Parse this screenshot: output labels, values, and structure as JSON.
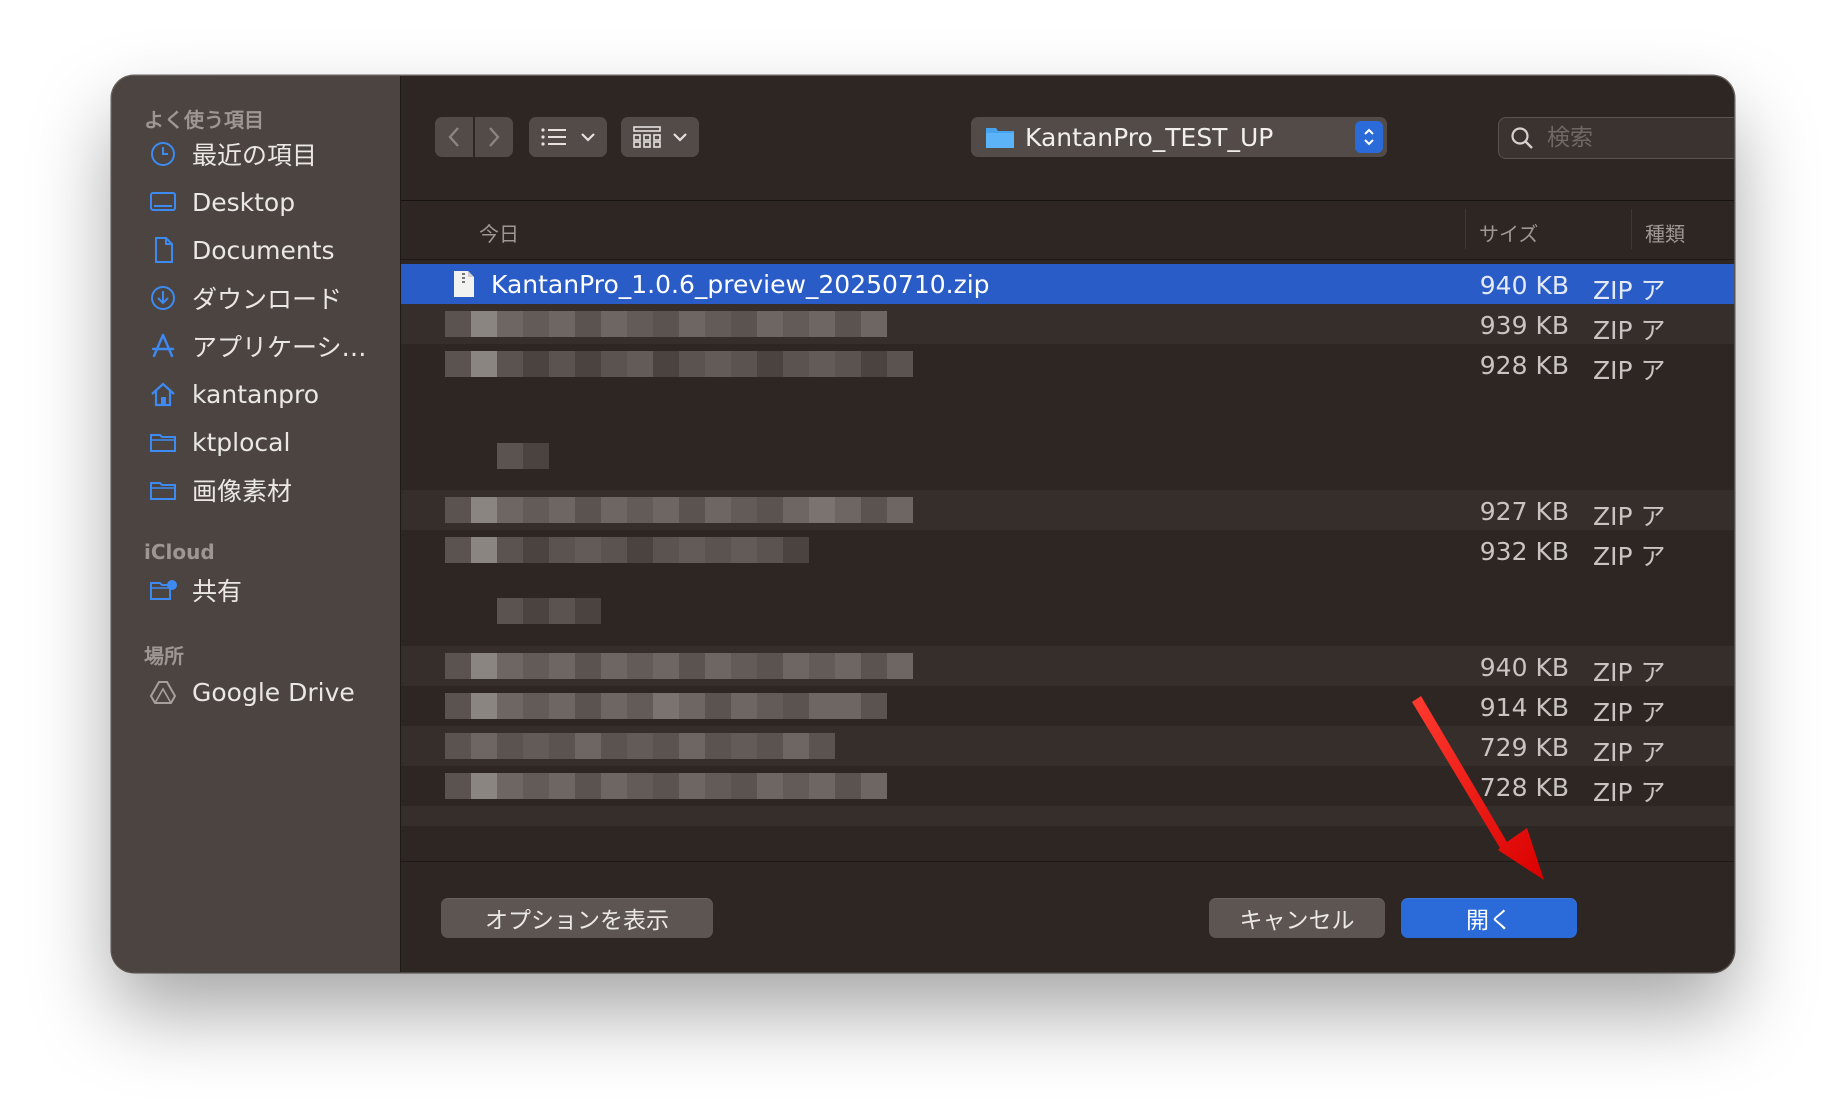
{
  "sidebar": {
    "favorites_header": "よく使う項目",
    "favorites": [
      {
        "label": "最近の項目",
        "icon": "clock-icon"
      },
      {
        "label": "Desktop",
        "icon": "desktop-icon"
      },
      {
        "label": "Documents",
        "icon": "document-icon"
      },
      {
        "label": "ダウンロード",
        "icon": "download-icon"
      },
      {
        "label": "アプリケーシ…",
        "icon": "applications-icon"
      },
      {
        "label": "kantanpro",
        "icon": "home-icon"
      },
      {
        "label": "ktplocal",
        "icon": "folder-icon"
      },
      {
        "label": "画像素材",
        "icon": "folder-icon"
      }
    ],
    "icloud_header": "iCloud",
    "icloud": [
      {
        "label": "共有",
        "icon": "shared-folder-icon"
      }
    ],
    "locations_header": "場所",
    "locations": [
      {
        "label": "Google Drive",
        "icon": "google-drive-icon"
      }
    ]
  },
  "toolbar": {
    "current_folder": "KantanPro_TEST_UP",
    "search_placeholder": "検索"
  },
  "columns": {
    "name": "今日",
    "size": "サイズ",
    "kind": "種類"
  },
  "files": [
    {
      "name": "KantanPro_1.0.6_preview_20250710.zip",
      "size": "940 KB",
      "kind": "ZIP ア",
      "selected": true
    },
    {
      "name": "",
      "size": "939 KB",
      "kind": "ZIP ア"
    },
    {
      "name": "",
      "size": "928 KB",
      "kind": "ZIP ア"
    },
    {
      "name": "",
      "size": "927 KB",
      "kind": "ZIP ア"
    },
    {
      "name": "",
      "size": "932 KB",
      "kind": "ZIP ア"
    },
    {
      "name": "",
      "size": "940 KB",
      "kind": "ZIP ア"
    },
    {
      "name": "",
      "size": "914 KB",
      "kind": "ZIP ア"
    },
    {
      "name": "",
      "size": "729 KB",
      "kind": "ZIP ア"
    },
    {
      "name": "",
      "size": "728 KB",
      "kind": "ZIP ア"
    }
  ],
  "footer": {
    "options_label": "オプションを表示",
    "cancel_label": "キャンセル",
    "open_label": "開く"
  },
  "colors": {
    "accent": "#2a6bd9",
    "selection": "#2a5cc7",
    "annotation_arrow": "#ff1a1a"
  }
}
